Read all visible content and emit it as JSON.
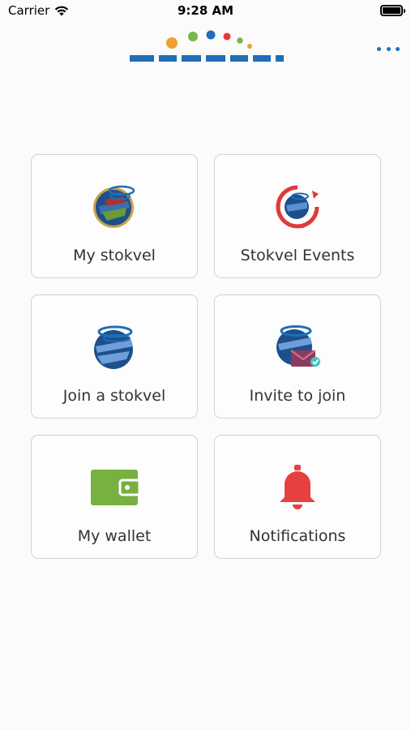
{
  "status": {
    "carrier": "Carrier",
    "time": "9:28 AM"
  },
  "header": {
    "logo_icon": "brand-logo",
    "menu_icon": "more-dots-icon"
  },
  "colors": {
    "accent": "#1e6fb5",
    "wallet": "#78b041",
    "bell": "#e74040",
    "events": "#e03a3a"
  },
  "menu": [
    {
      "label": "My stokvel",
      "icon": "globe-stokvel-icon"
    },
    {
      "label": "Stokvel Events",
      "icon": "calendar-refresh-icon"
    },
    {
      "label": "Join a stokvel",
      "icon": "globe-join-icon"
    },
    {
      "label": "Invite to join",
      "icon": "sms-invite-icon"
    },
    {
      "label": "My wallet",
      "icon": "wallet-icon"
    },
    {
      "label": "Notifications",
      "icon": "bell-icon"
    }
  ]
}
